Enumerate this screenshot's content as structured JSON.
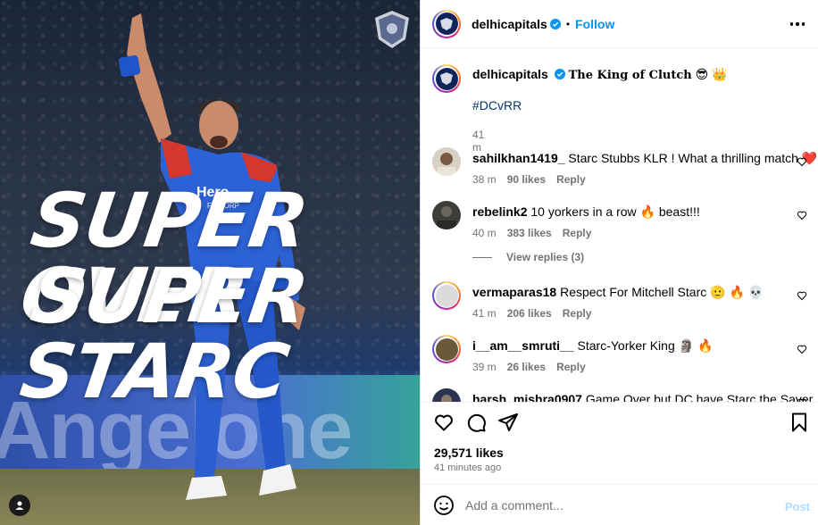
{
  "media": {
    "headline_line1": "SUPER OVER",
    "headline_line2": "SUPER STARC",
    "adboard_text": "Angelone",
    "jersey_sponsor": "Hero",
    "jersey_sponsor_sub": "FINCORP",
    "team_logo_label": "DELHI CAPITALS"
  },
  "header": {
    "username": "delhicapitals",
    "dot": "•",
    "follow_label": "Follow"
  },
  "caption": {
    "username": "delhicapitals",
    "text": "The King of Clutch",
    "emoji": "😎 👑",
    "hashtag": "#DCvRR",
    "time": "41 m"
  },
  "comments": [
    {
      "user": "sahilkhan1419_",
      "text": "Starc Stubbs KLR ! What a thrilling match ❤️ 😳",
      "time": "38 m",
      "likes": "90 likes",
      "reply": "Reply"
    },
    {
      "user": "rebelink2",
      "text": "10 yorkers in a row 🔥 beast!!!",
      "time": "40 m",
      "likes": "383 likes",
      "reply": "Reply"
    },
    {
      "user": "vermaparas18",
      "text": "Respect For Mitchell Starc 🫡 🔥 💀",
      "time": "41 m",
      "likes": "206 likes",
      "reply": "Reply"
    },
    {
      "user": "i__am__smruti__",
      "text": "Starc-Yorker King 🗿 🔥",
      "time": "39 m",
      "likes": "26 likes",
      "reply": "Reply"
    },
    {
      "user": "harsh_mishra0907",
      "text": "Game Over but DC have Starc the Saver 🔥",
      "time": "",
      "likes": "",
      "reply": ""
    }
  ],
  "view_replies": "View replies (3)",
  "actions": {
    "likes": "29,571 likes",
    "ago": "41 minutes ago"
  },
  "add_comment": {
    "placeholder": "Add a comment...",
    "post_label": "Post"
  },
  "colors": {
    "accent": "#0095f6",
    "verified": "#0095f6",
    "muted": "#737373",
    "hashtag": "#00376b",
    "team_navy": "#10245c"
  }
}
